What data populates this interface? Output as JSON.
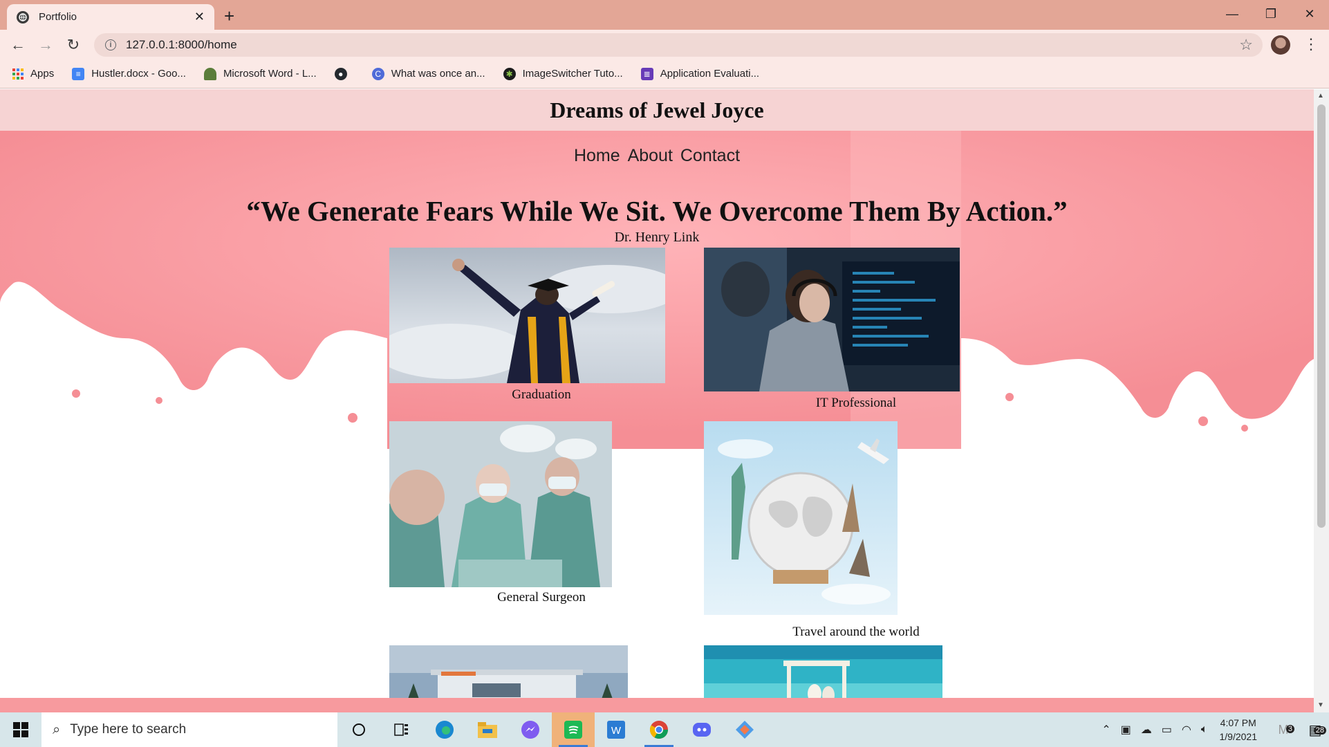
{
  "browser": {
    "tab_title": "Portfolio",
    "url": "127.0.0.1:8000/home",
    "bookmarks": [
      {
        "label": "Apps",
        "icon": "apps-grid-icon"
      },
      {
        "label": "Hustler.docx - Goo...",
        "icon": "google-docs-icon"
      },
      {
        "label": "Microsoft Word - L...",
        "icon": "tree-icon"
      },
      {
        "label": "",
        "icon": "github-icon"
      },
      {
        "label": "What was once an...",
        "icon": "c-circle-icon"
      },
      {
        "label": "ImageSwitcher Tuto...",
        "icon": "android-icon"
      },
      {
        "label": "Application Evaluati...",
        "icon": "forms-icon"
      }
    ]
  },
  "site": {
    "title": "Dreams of Jewel Joyce",
    "nav": [
      "Home",
      "About",
      "Contact"
    ],
    "quote": "“We Generate Fears While We Sit. We Overcome Them By Action.”",
    "author": "Dr. Henry Link",
    "cards": [
      {
        "caption": "Graduation",
        "image": "graduate-photo"
      },
      {
        "caption": "IT Professional",
        "image": "it-professional-photo"
      },
      {
        "caption": "General Surgeon",
        "image": "surgeons-photo"
      },
      {
        "caption": "Travel around the world",
        "image": "world-travel-photo"
      },
      {
        "caption": "",
        "image": "house-photo"
      },
      {
        "caption": "",
        "image": "beach-wedding-photo"
      }
    ]
  },
  "taskbar": {
    "search_placeholder": "Type here to search",
    "time": "4:07 PM",
    "date": "1/9/2021",
    "notification_count": "28",
    "mail_badge": "3"
  },
  "colors": {
    "titlebar": "#e3a696",
    "pink_bg": "#f79a9e",
    "header_bg": "#f6d3d3",
    "taskbar": "#d7e6ea"
  }
}
